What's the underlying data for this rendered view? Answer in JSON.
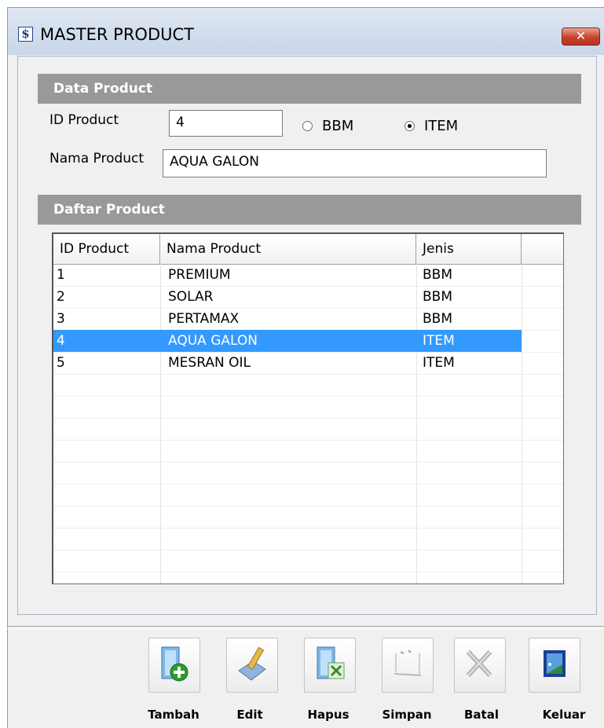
{
  "window": {
    "title": "MASTER PRODUCT",
    "icon": "app-logo-icon",
    "close_label": "✕"
  },
  "data_section": {
    "header": "Data Product",
    "id_label": "ID Product",
    "id_value": "4",
    "name_label": "Nama Product",
    "name_value": "AQUA GALON",
    "radio_bbm": "BBM",
    "radio_item": "ITEM",
    "selected_type": "ITEM"
  },
  "list_section": {
    "header": "Daftar Product",
    "columns": [
      "ID Product",
      "Nama Product",
      "Jenis"
    ],
    "rows": [
      {
        "id": "1",
        "name": "PREMIUM",
        "jenis": "BBM"
      },
      {
        "id": "2",
        "name": "SOLAR",
        "jenis": "BBM"
      },
      {
        "id": "3",
        "name": "PERTAMAX",
        "jenis": "BBM"
      },
      {
        "id": "4",
        "name": "AQUA GALON",
        "jenis": "ITEM"
      },
      {
        "id": "5",
        "name": "MESRAN OIL",
        "jenis": "ITEM"
      }
    ],
    "selected_row": 3
  },
  "toolbar": {
    "buttons": [
      {
        "label": "Tambah",
        "icon": "add-icon",
        "enabled": true
      },
      {
        "label": "Edit",
        "icon": "edit-icon",
        "enabled": true
      },
      {
        "label": "Hapus",
        "icon": "delete-icon",
        "enabled": true
      },
      {
        "label": "Simpan",
        "icon": "save-icon",
        "enabled": false
      },
      {
        "label": "Batal",
        "icon": "cancel-icon",
        "enabled": false
      },
      {
        "label": "Keluar",
        "icon": "exit-icon",
        "enabled": true
      }
    ]
  },
  "colors": {
    "selection": "#3399ff",
    "section_header": "#999999",
    "close_button": "#c7432c"
  }
}
